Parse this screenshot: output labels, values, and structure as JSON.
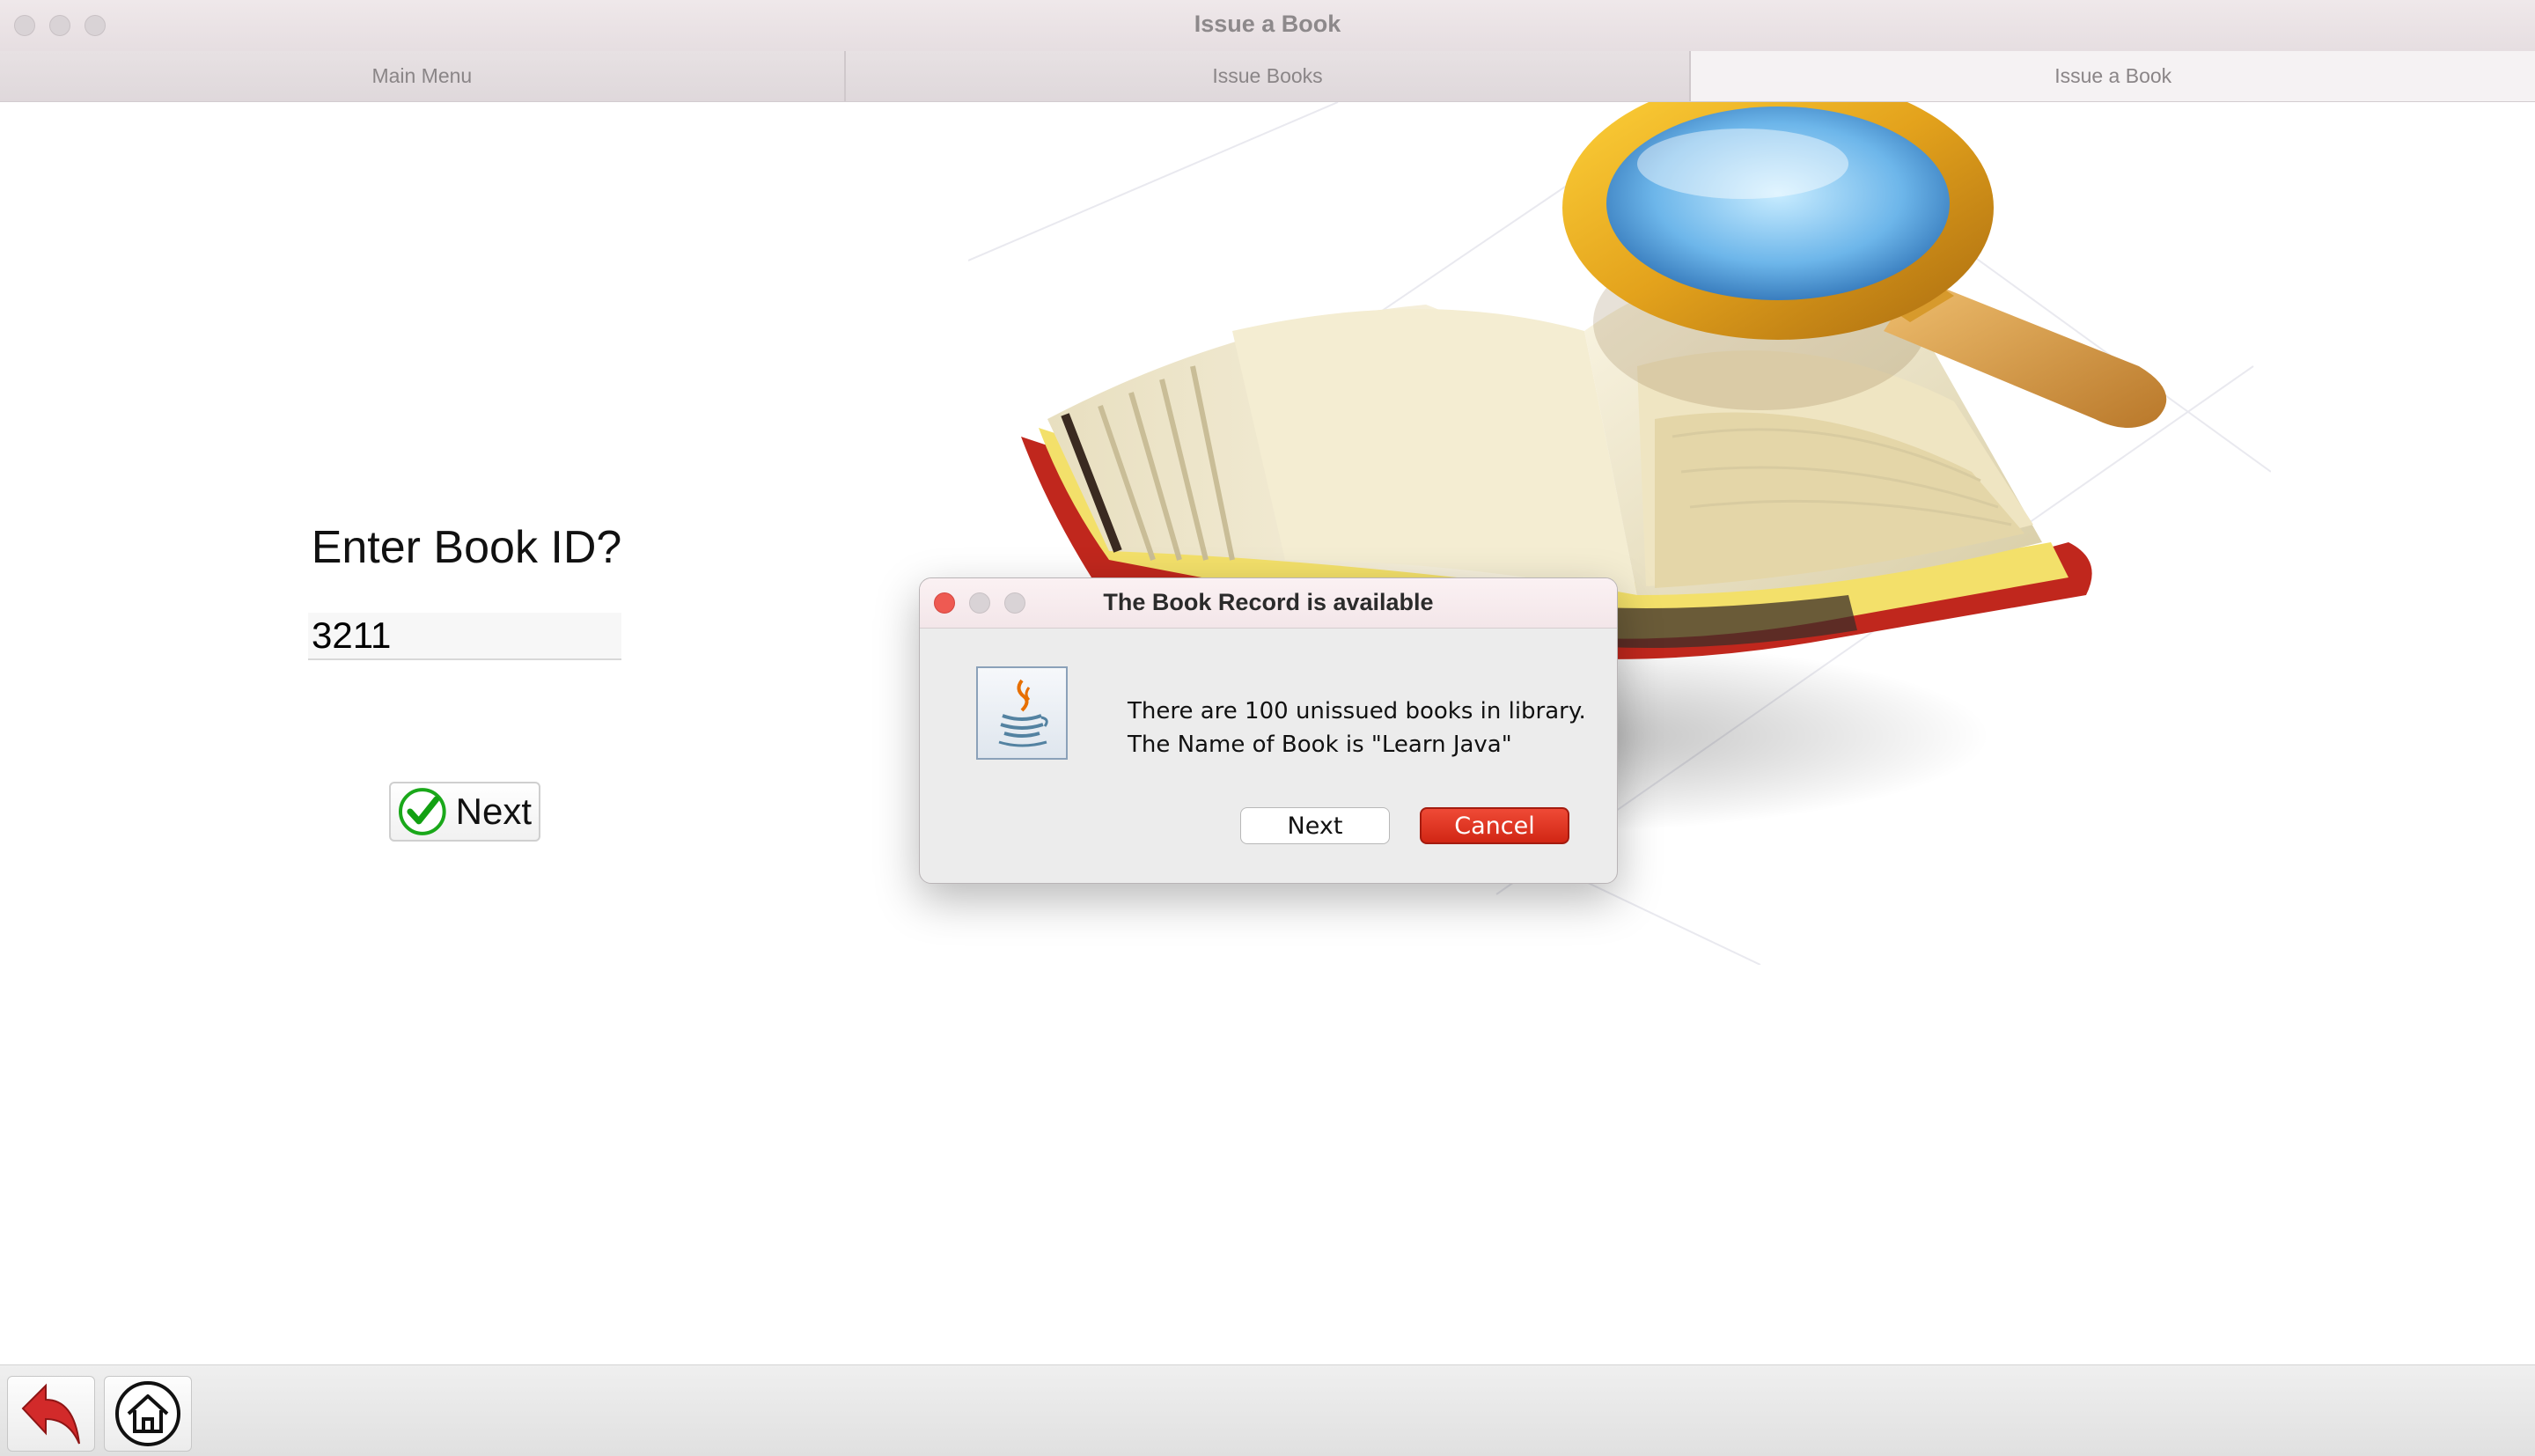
{
  "window": {
    "title": "Issue a Book",
    "accent_color": "#d83a52"
  },
  "tabs": [
    {
      "label": "Main Menu"
    },
    {
      "label": "Issue Books"
    },
    {
      "label": "Issue a Book"
    }
  ],
  "form": {
    "prompt": "Enter Book ID?",
    "book_id_value": "3211",
    "next_label": "Next"
  },
  "dialog": {
    "title": "The Book Record is available",
    "message_line1": "There are 100 unissued books in library.",
    "message_line2": "The Name of Book is \"Learn Java\"",
    "next_label": "Next",
    "cancel_label": "Cancel",
    "cancel_color": "#d9301d",
    "icon": "java-icon"
  },
  "toolbar": {
    "back_icon": "back-arrow-icon",
    "home_icon": "home-icon"
  }
}
